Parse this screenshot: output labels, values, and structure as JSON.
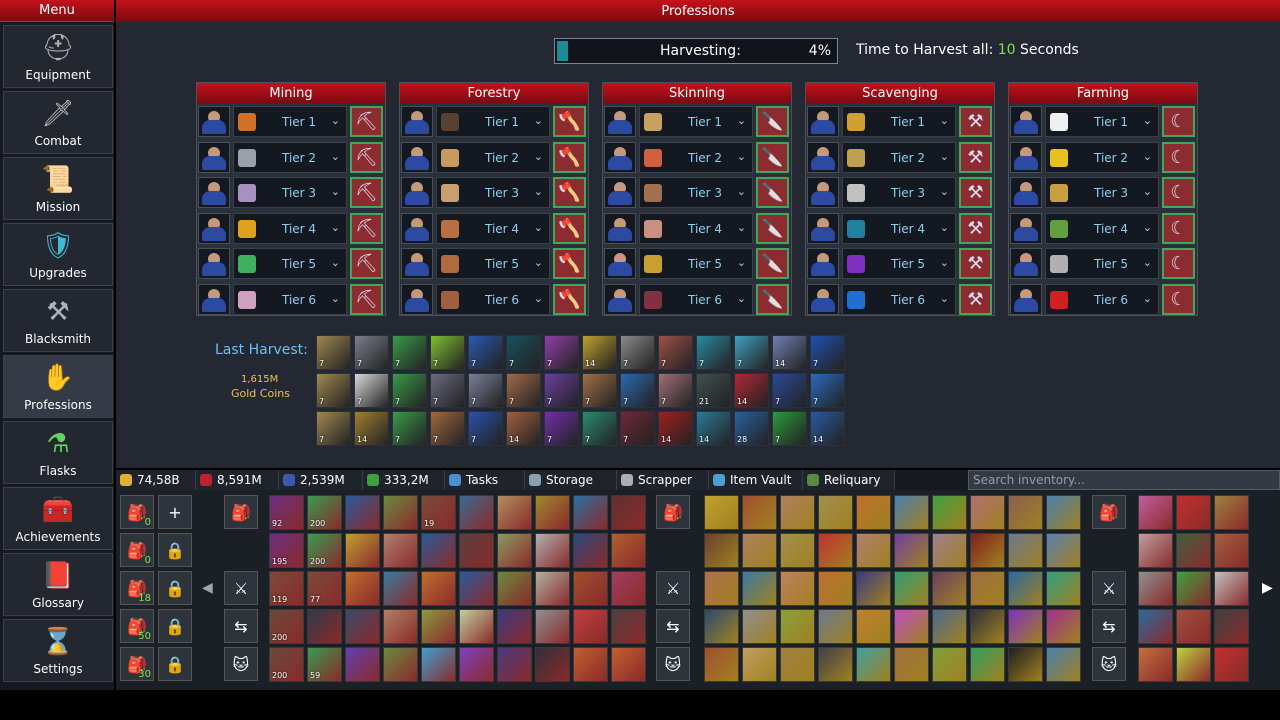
{
  "header": {
    "menu_title": "Menu",
    "professions_title": "Professions"
  },
  "sidebar": [
    {
      "label": "Equipment",
      "icon": "helmet-icon",
      "glyph": "⛑",
      "color": "#b0b0b0"
    },
    {
      "label": "Combat",
      "icon": "sword-icon",
      "glyph": "🗡",
      "color": "#bbbbbb"
    },
    {
      "label": "Mission",
      "icon": "scroll-icon",
      "glyph": "📜",
      "color": "#e0c080"
    },
    {
      "label": "Upgrades",
      "icon": "shield-icon",
      "glyph": "🛡",
      "color": "#3fb9d8"
    },
    {
      "label": "Blacksmith",
      "icon": "anvil-icon",
      "glyph": "⚒",
      "color": "#aab4c0"
    },
    {
      "label": "Professions",
      "icon": "professions-icon",
      "glyph": "✋",
      "color": "#e0b230"
    },
    {
      "label": "Flasks",
      "icon": "flask-icon",
      "glyph": "⚗",
      "color": "#5fd25f"
    },
    {
      "label": "Achievements",
      "icon": "chest-icon",
      "glyph": "🧰",
      "color": "#c8a050"
    },
    {
      "label": "Glossary",
      "icon": "book-icon",
      "glyph": "📕",
      "color": "#d03030"
    },
    {
      "label": "Settings",
      "icon": "hourglass-icon",
      "glyph": "⌛",
      "color": "#d0c080"
    }
  ],
  "harvest": {
    "label": "Harvesting:",
    "percent_text": "4%",
    "progress": 0.04,
    "time_prefix": "Time to Harvest all:",
    "time_value": "10",
    "time_suffix": "Seconds"
  },
  "professions": [
    {
      "name": "Mining",
      "tool_icon": "pickaxe-icon",
      "tool_glyph": "⛏",
      "tiers": [
        "Tier 1",
        "Tier 2",
        "Tier 3",
        "Tier 4",
        "Tier 5",
        "Tier 6"
      ],
      "res_colors": [
        "#d0702a",
        "#9aa0a8",
        "#a890c0",
        "#e0a020",
        "#40b060",
        "#d0a0c0"
      ]
    },
    {
      "name": "Forestry",
      "tool_icon": "axe-icon",
      "tool_glyph": "🪓",
      "tiers": [
        "Tier 1",
        "Tier 2",
        "Tier 3",
        "Tier 4",
        "Tier 5",
        "Tier 6"
      ],
      "res_colors": [
        "#5a4030",
        "#c89a60",
        "#c8a070",
        "#b87040",
        "#b06a40",
        "#a06040"
      ]
    },
    {
      "name": "Skinning",
      "tool_icon": "knife-icon",
      "tool_glyph": "🔪",
      "tiers": [
        "Tier 1",
        "Tier 2",
        "Tier 3",
        "Tier 4",
        "Tier 5",
        "Tier 6"
      ],
      "res_colors": [
        "#c8a060",
        "#d06040",
        "#a07050",
        "#c89080",
        "#c8a030",
        "#803040"
      ]
    },
    {
      "name": "Scavenging",
      "tool_icon": "trowel-icon",
      "tool_glyph": "⚒",
      "tiers": [
        "Tier 1",
        "Tier 2",
        "Tier 3",
        "Tier 4",
        "Tier 5",
        "Tier 6"
      ],
      "res_colors": [
        "#d0a030",
        "#c0a050",
        "#c0c0c0",
        "#2080a0",
        "#8030c0",
        "#2070d0"
      ]
    },
    {
      "name": "Farming",
      "tool_icon": "sickle-icon",
      "tool_glyph": "☾",
      "tiers": [
        "Tier 1",
        "Tier 2",
        "Tier 3",
        "Tier 4",
        "Tier 5",
        "Tier 6"
      ],
      "res_colors": [
        "#f0f0f0",
        "#e8c020",
        "#c8a040",
        "#60a040",
        "#b0b0b0",
        "#d02020"
      ]
    }
  ],
  "last_harvest": {
    "label": "Last Harvest:",
    "gold_amount": "1,615M",
    "gold_label": "Gold Coins",
    "items": [
      {
        "c": "#a08850",
        "n": "7"
      },
      {
        "c": "#7a7f88",
        "n": "7"
      },
      {
        "c": "#3a9a4a",
        "n": "7"
      },
      {
        "c": "#80c030",
        "n": "7"
      },
      {
        "c": "#2a5ab0",
        "n": "7"
      },
      {
        "c": "#185060",
        "n": "7"
      },
      {
        "c": "#9040a8",
        "n": "7"
      },
      {
        "c": "#c0a030",
        "n": "14"
      },
      {
        "c": "#8a8a8a",
        "n": "7"
      },
      {
        "c": "#a05048",
        "n": "7"
      },
      {
        "c": "#2a8aa0",
        "n": "7"
      },
      {
        "c": "#40a0c0",
        "n": "7"
      },
      {
        "c": "#7080b0",
        "n": "14"
      },
      {
        "c": "#2050b0",
        "n": "7"
      },
      {
        "c": "#a08850",
        "n": "7"
      },
      {
        "c": "#d8d8d8",
        "n": "7"
      },
      {
        "c": "#3a9a4a",
        "n": "7"
      },
      {
        "c": "#6a6a80",
        "n": "7"
      },
      {
        "c": "#7a7f98",
        "n": "7"
      },
      {
        "c": "#a06a48",
        "n": "7"
      },
      {
        "c": "#6a40a0",
        "n": "7"
      },
      {
        "c": "#a07048",
        "n": "7"
      },
      {
        "c": "#2a6ab0",
        "n": "7"
      },
      {
        "c": "#a07078",
        "n": "7"
      },
      {
        "c": "#405050",
        "n": "21"
      },
      {
        "c": "#b02838",
        "n": "14"
      },
      {
        "c": "#2a4a98",
        "n": "7"
      },
      {
        "c": "#2a6ac0",
        "n": "7"
      },
      {
        "c": "#a08850",
        "n": "7"
      },
      {
        "c": "#a08030",
        "n": "14"
      },
      {
        "c": "#3a9a4a",
        "n": "7"
      },
      {
        "c": "#a06840",
        "n": "7"
      },
      {
        "c": "#2a50a8",
        "n": "7"
      },
      {
        "c": "#a06040",
        "n": "14"
      },
      {
        "c": "#7030a8",
        "n": "7"
      },
      {
        "c": "#2a8a70",
        "n": "7"
      },
      {
        "c": "#702838",
        "n": "7"
      },
      {
        "c": "#a02020",
        "n": "14"
      },
      {
        "c": "#2a7a98",
        "n": "14"
      },
      {
        "c": "#2a60a0",
        "n": "28"
      },
      {
        "c": "#2a9a40",
        "n": "7"
      },
      {
        "c": "#2a5aa0",
        "n": "14"
      }
    ]
  },
  "currencies": [
    {
      "value": "74,58B",
      "icon": "gold-icon",
      "color": "#e0b030"
    },
    {
      "value": "8,591M",
      "icon": "ruby-icon",
      "color": "#c02030"
    },
    {
      "value": "2,539M",
      "icon": "skull-icon",
      "color": "#3a5ab0"
    },
    {
      "value": "333,2M",
      "icon": "gem-icon",
      "color": "#40a040"
    }
  ],
  "tabs": [
    {
      "label": "Tasks",
      "icon": "tasks-icon",
      "color": "#4a90d0"
    },
    {
      "label": "Storage",
      "icon": "storage-icon",
      "color": "#8aa0b0"
    },
    {
      "label": "Scrapper",
      "icon": "scrapper-icon",
      "color": "#aab0b8"
    },
    {
      "label": "Item Vault",
      "icon": "vault-icon",
      "color": "#4aa0d0"
    },
    {
      "label": "Reliquary",
      "icon": "reliquary-icon",
      "color": "#5a8a40"
    }
  ],
  "search_placeholder": "Search inventory...",
  "bags": [
    {
      "count": "0"
    },
    {
      "count": "0"
    },
    {
      "count": "18"
    },
    {
      "count": "50"
    },
    {
      "count": "30"
    }
  ],
  "inv_left": [
    {
      "c": "#6a3080",
      "n": "92"
    },
    {
      "c": "#3a9a50",
      "n": "200"
    },
    {
      "c": "#2a5a9a",
      "n": ""
    },
    {
      "c": "#6a8a40",
      "n": ""
    },
    {
      "c": "#7a4a3a",
      "n": "19"
    },
    {
      "c": "#3a6a90",
      "n": ""
    },
    {
      "c": "#b09060",
      "n": ""
    },
    {
      "c": "#a08830",
      "n": ""
    },
    {
      "c": "#2a70a0",
      "n": ""
    },
    {
      "c": "#603030",
      "n": ""
    },
    {
      "c": "#6a3080",
      "n": "195"
    },
    {
      "c": "#3a9a50",
      "n": "200"
    },
    {
      "c": "#c0a030",
      "n": ""
    },
    {
      "c": "#b08070",
      "n": ""
    },
    {
      "c": "#2a5a9a",
      "n": ""
    },
    {
      "c": "#5a4040",
      "n": ""
    },
    {
      "c": "#8a9a60",
      "n": ""
    },
    {
      "c": "#b0b0b0",
      "n": ""
    },
    {
      "c": "#2a4a7a",
      "n": ""
    },
    {
      "c": "#b06030",
      "n": ""
    },
    {
      "c": "#7a4a3a",
      "n": "119"
    },
    {
      "c": "#7a4a3a",
      "n": "77"
    },
    {
      "c": "#c07030",
      "n": ""
    },
    {
      "c": "#3a7aa0",
      "n": ""
    },
    {
      "c": "#c07030",
      "n": ""
    },
    {
      "c": "#2a5a9a",
      "n": ""
    },
    {
      "c": "#6a8a40",
      "n": ""
    },
    {
      "c": "#b0b0a0",
      "n": ""
    },
    {
      "c": "#a05030",
      "n": ""
    },
    {
      "c": "#a04060",
      "n": ""
    },
    {
      "c": "#6a4a3a",
      "n": "200"
    },
    {
      "c": "#303a48",
      "n": ""
    },
    {
      "c": "#3a4a68",
      "n": ""
    },
    {
      "c": "#b08060",
      "n": ""
    },
    {
      "c": "#8a9a40",
      "n": ""
    },
    {
      "c": "#c0d0a0",
      "n": ""
    },
    {
      "c": "#3a3a80",
      "n": ""
    },
    {
      "c": "#909090",
      "n": ""
    },
    {
      "c": "#c04040",
      "n": ""
    },
    {
      "c": "#504040",
      "n": ""
    },
    {
      "c": "#6a4a3a",
      "n": "200"
    },
    {
      "c": "#3a9a50",
      "n": "59"
    },
    {
      "c": "#6040b0",
      "n": ""
    },
    {
      "c": "#6a8a40",
      "n": ""
    },
    {
      "c": "#40a0d0",
      "n": ""
    },
    {
      "c": "#8040c0",
      "n": ""
    },
    {
      "c": "#4a3a80",
      "n": ""
    },
    {
      "c": "#303038",
      "n": ""
    },
    {
      "c": "#c06030",
      "n": ""
    },
    {
      "c": "#c06030",
      "n": ""
    }
  ],
  "inv_right": [
    {
      "c": "#c0a030"
    },
    {
      "c": "#a05030"
    },
    {
      "c": "#b08060"
    },
    {
      "c": "#a09050"
    },
    {
      "c": "#c07030"
    },
    {
      "c": "#4a80b0"
    },
    {
      "c": "#40a040"
    },
    {
      "c": "#b07070"
    },
    {
      "c": "#8a6050"
    },
    {
      "c": "#4a80b0"
    },
    {
      "c": "#6a4030"
    },
    {
      "c": "#b08060"
    },
    {
      "c": "#a09050"
    },
    {
      "c": "#c03030"
    },
    {
      "c": "#b08070"
    },
    {
      "c": "#7040a0"
    },
    {
      "c": "#a08090"
    },
    {
      "c": "#802020"
    },
    {
      "c": "#6a7a90"
    },
    {
      "c": "#5a80b0"
    },
    {
      "c": "#b07050"
    },
    {
      "c": "#3a7aa0"
    },
    {
      "c": "#c08060"
    },
    {
      "c": "#c07030"
    },
    {
      "c": "#3a3a80"
    },
    {
      "c": "#30a070"
    },
    {
      "c": "#6a4060"
    },
    {
      "c": "#a07040"
    },
    {
      "c": "#2a6aa0"
    },
    {
      "c": "#30a080"
    },
    {
      "c": "#2a4a70"
    },
    {
      "c": "#909090"
    },
    {
      "c": "#8aa040"
    },
    {
      "c": "#6a7a90"
    },
    {
      "c": "#c08030"
    },
    {
      "c": "#c050c0"
    },
    {
      "c": "#4a6a90"
    },
    {
      "c": "#303038"
    },
    {
      "c": "#8030c0"
    },
    {
      "c": "#a03090"
    },
    {
      "c": "#a05030"
    },
    {
      "c": "#c0a060"
    },
    {
      "c": "#a08040"
    },
    {
      "c": "#404048"
    },
    {
      "c": "#40a0a0"
    },
    {
      "c": "#a07040"
    },
    {
      "c": "#80a040"
    },
    {
      "c": "#30a060"
    },
    {
      "c": "#202020"
    },
    {
      "c": "#4a80b0"
    }
  ],
  "inv_far_right": [
    {
      "c": "#c060a0"
    },
    {
      "c": "#c03030"
    },
    {
      "c": "#a08040"
    },
    {
      "c": "#c0a0a0"
    },
    {
      "c": "#406040"
    },
    {
      "c": "#a06040"
    },
    {
      "c": "#909090"
    },
    {
      "c": "#40a040"
    },
    {
      "c": "#c0c0c0"
    },
    {
      "c": "#2a6aa0"
    },
    {
      "c": "#a05040"
    },
    {
      "c": "#404040"
    },
    {
      "c": "#c07040"
    },
    {
      "c": "#c0d040"
    },
    {
      "c": "#c03030"
    }
  ]
}
